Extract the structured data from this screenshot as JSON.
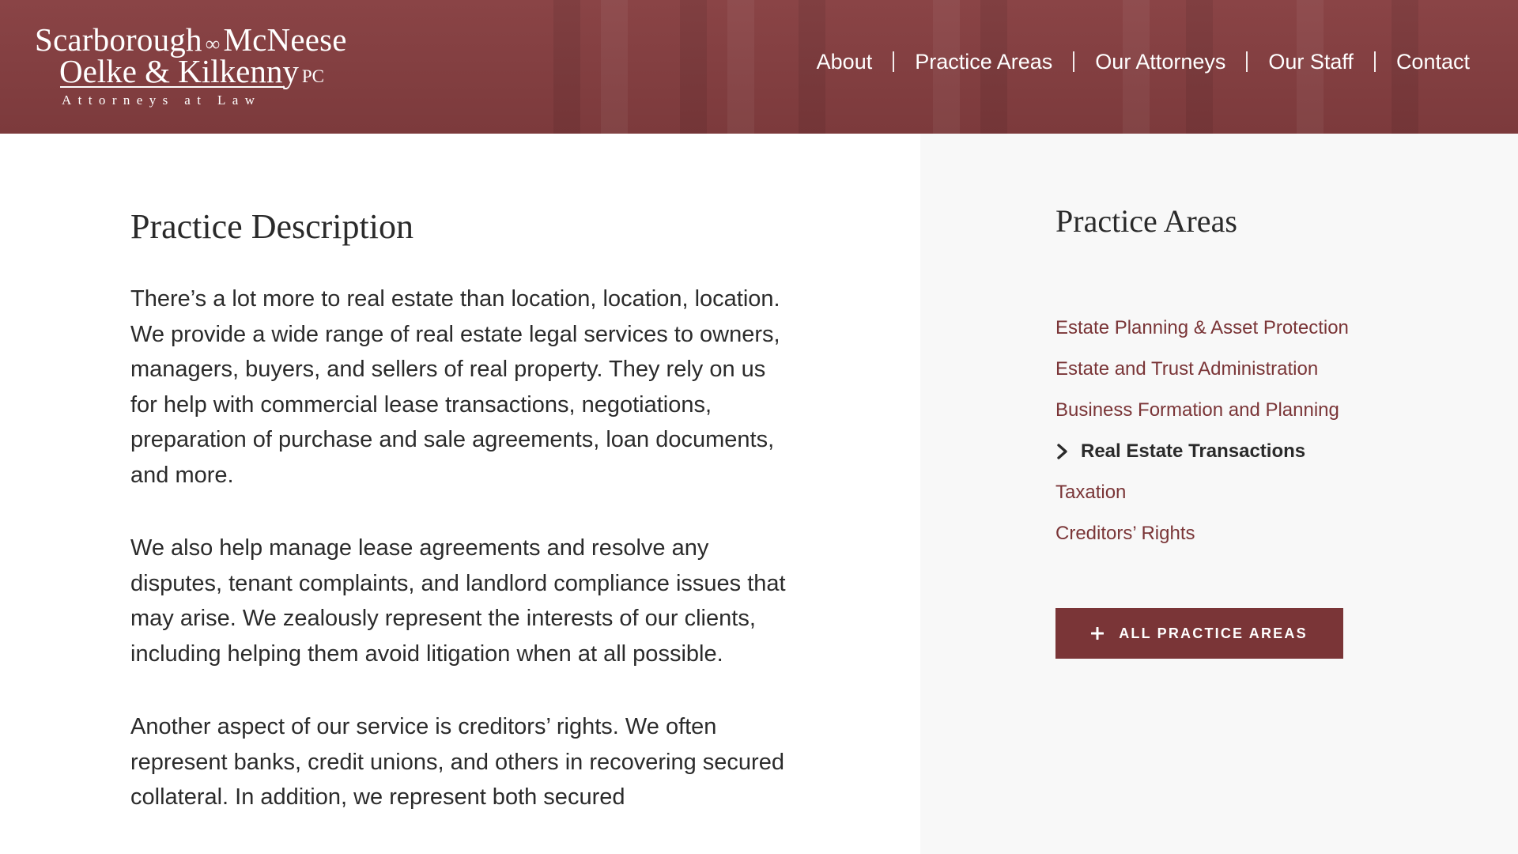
{
  "logo": {
    "line1_a": "Scarborough",
    "line1_b": "McNeese",
    "line2": "Oelke & Kilkenny",
    "line2_suffix": "PC",
    "tagline": "Attorneys at Law"
  },
  "nav": {
    "items": [
      "About",
      "Practice Areas",
      "Our Attorneys",
      "Our Staff",
      "Contact"
    ]
  },
  "main": {
    "title": "Practice Description",
    "paragraphs": [
      "There’s a lot more to real estate than location, location, location. We provide a wide range of real estate legal services to owners, managers, buyers, and sellers of real property. They rely on us for help with commercial lease transactions, negotiations, preparation of purchase and sale agreements, loan documents, and more.",
      "We also help manage lease agreements and resolve any disputes, tenant complaints, and landlord compliance issues that may arise. We zealously represent the interests of our clients, including helping them avoid litigation when at all possible.",
      "Another aspect of our service is creditors’ rights. We often represent banks, credit unions, and others in recovering secured collateral. In addition, we represent both secured"
    ]
  },
  "sidebar": {
    "title": "Practice Areas",
    "items": [
      "Estate Planning & Asset Protection",
      "Estate and Trust Administration",
      "Business Formation and Planning",
      "Real Estate Transactions",
      "Taxation",
      "Creditors’ Rights"
    ],
    "active_item": "Real Estate Transactions",
    "button_label": "ALL PRACTICE AREAS"
  },
  "colors": {
    "brand": "#7c3a3c",
    "link": "#7a3537",
    "sidebar_bg": "#f8f8f8",
    "text": "#2a2a2a"
  },
  "icons": {
    "active_marker": "chevron-right-icon",
    "button": "plus-icon",
    "logo_ligature": "infinity-ampersand-icon"
  }
}
